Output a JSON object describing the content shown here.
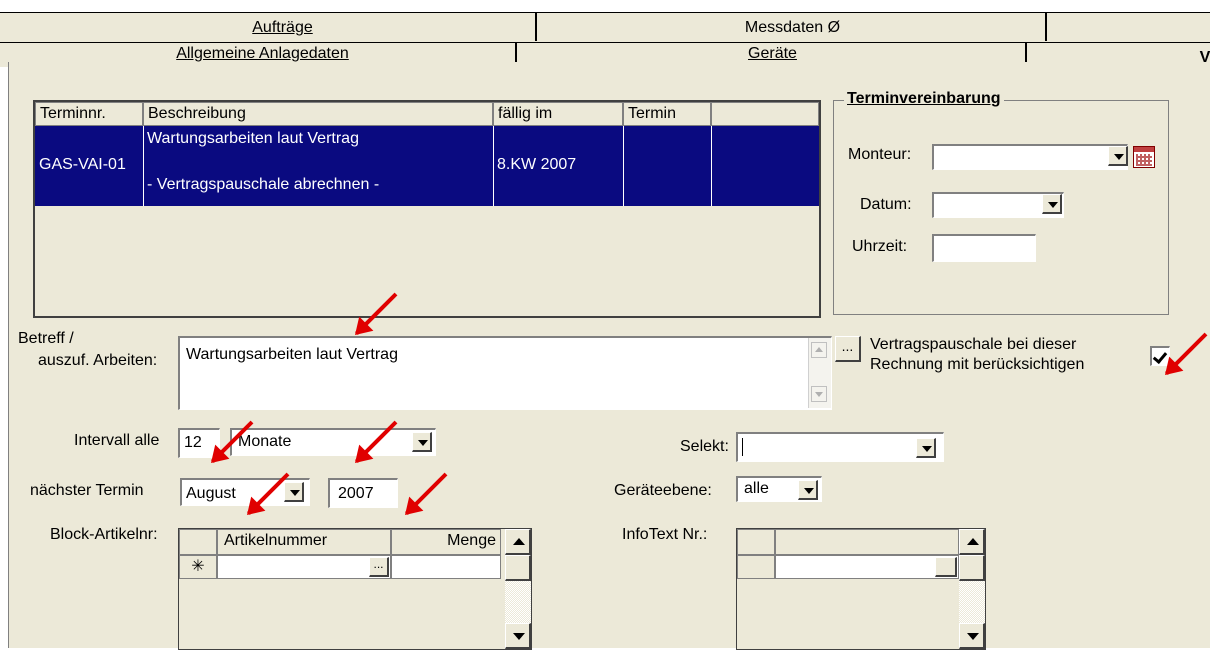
{
  "tabs_row1": [
    {
      "label": "Aufträge"
    },
    {
      "label": "Messdaten Ø"
    }
  ],
  "tabs_row2": [
    {
      "label": "Allgemeine Anlagedaten"
    },
    {
      "label": "Geräte"
    },
    {
      "label": "V"
    }
  ],
  "table": {
    "columns": [
      "Terminnr.",
      "Beschreibung",
      "fällig im",
      "Termin"
    ],
    "rows": [
      {
        "terminnr": "GAS-VAI-01",
        "beschreibung_1": "Wartungsarbeiten laut Vertrag",
        "beschreibung_2": "- Vertragspauschale abrechnen -",
        "faellig": "8.KW  2007",
        "termin": ""
      }
    ]
  },
  "terminvereinbarung": {
    "title": "Terminvereinbarung",
    "monteur_label": "Monteur:",
    "monteur_value": "",
    "datum_label": "Datum:",
    "datum_value": "",
    "uhrzeit_label": "Uhrzeit:",
    "uhrzeit_value": ""
  },
  "betreff": {
    "label_1": "Betreff /",
    "label_2": "auszuf. Arbeiten:",
    "value": "Wartungsarbeiten laut Vertrag",
    "ellipsis": "..."
  },
  "vertragspauschale": {
    "label_1": "Vertragspauschale bei dieser",
    "label_2": "Rechnung mit berücksichtigen",
    "checked": true
  },
  "intervall": {
    "label": "Intervall alle",
    "value": "12",
    "unit": "Monate"
  },
  "naechster_termin": {
    "label": "nächster Termin",
    "month": "August",
    "year": "2007"
  },
  "selekt": {
    "label": "Selekt:",
    "value": ""
  },
  "geraeteebene": {
    "label": "Geräteebene:",
    "value": "alle"
  },
  "block_artikel": {
    "label": "Block-Artikelnr:",
    "col_artikel": "Artikelnummer",
    "col_menge": "Menge",
    "new_row_marker": "✳",
    "ellipsis": "..."
  },
  "infotext": {
    "label": "InfoText Nr.:"
  },
  "colors": {
    "selection": "#0a0a80",
    "arrow": "#e00000",
    "panel": "#ece9d8"
  }
}
